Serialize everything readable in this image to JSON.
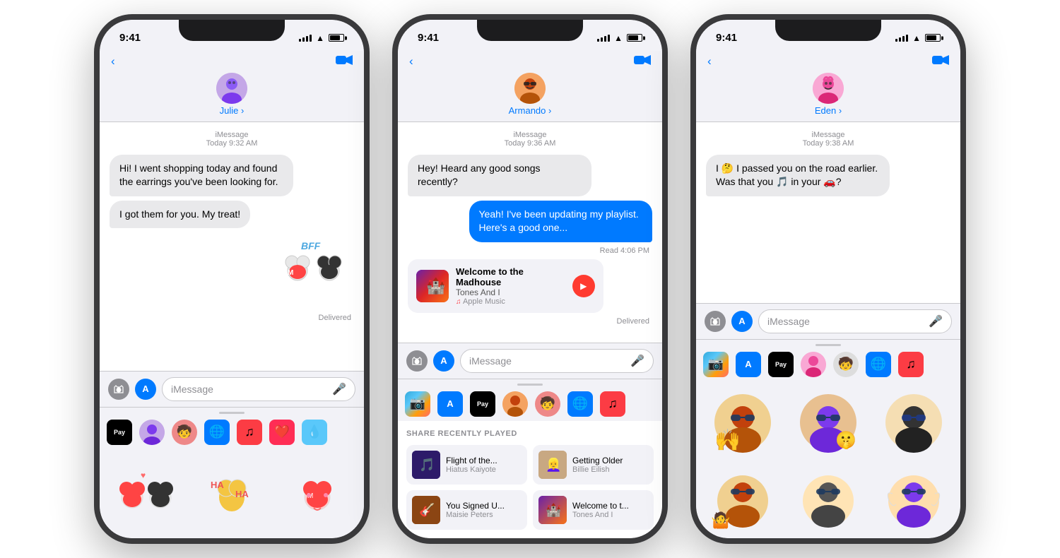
{
  "phones": [
    {
      "id": "phone1",
      "status": {
        "time": "9:41",
        "signal": [
          3,
          4,
          5,
          6,
          7
        ],
        "wifi": true,
        "battery": true
      },
      "header": {
        "contact_name": "Julie ›",
        "avatar_emoji": "🧑‍🎤",
        "avatar_bg": "#c4a7e7"
      },
      "messages": [
        {
          "type": "timestamp",
          "text": "iMessage\nToday 9:32 AM"
        },
        {
          "type": "received",
          "text": "Hi! I went shopping today and found the earrings you've been looking for."
        },
        {
          "type": "received",
          "text": "I got them for you. My treat!"
        },
        {
          "type": "sticker",
          "emoji": "🐭",
          "label": "BFF Sticker"
        },
        {
          "type": "status",
          "text": "Delivered"
        }
      ],
      "input_placeholder": "iMessage",
      "panel_type": "stickers",
      "drawer_icons": [
        "📷",
        "A",
        "ApplePay",
        "🧑",
        "🧒",
        "🌐",
        "♪",
        "❤️",
        "💧"
      ]
    },
    {
      "id": "phone2",
      "status": {
        "time": "9:41"
      },
      "header": {
        "contact_name": "Armando ›",
        "avatar_emoji": "🧑‍🦱",
        "avatar_bg": "#f4a261"
      },
      "messages": [
        {
          "type": "timestamp",
          "text": "iMessage\nToday 9:36 AM"
        },
        {
          "type": "received",
          "text": "Hey! Heard any good songs recently?"
        },
        {
          "type": "sent",
          "text": "Yeah! I've been updating my playlist. Here's a good one..."
        },
        {
          "type": "read",
          "text": "Read 4:06 PM"
        },
        {
          "type": "music_card",
          "title": "Welcome to the Madhouse",
          "artist": "Tones And I",
          "service": "Apple Music",
          "thumb_emoji": "🏰"
        },
        {
          "type": "status",
          "text": "Delivered"
        }
      ],
      "input_placeholder": "iMessage",
      "panel_type": "music",
      "panel_title": "SHARE RECENTLY PLAYED",
      "recently_played": [
        {
          "title": "Flight of the...",
          "artist": "Hiatus Kaiyote",
          "bg": "#2d1b69"
        },
        {
          "title": "Getting Older",
          "artist": "Billie Eilish",
          "bg": "#c8a882"
        },
        {
          "title": "You Signed U...",
          "artist": "Maisie Peters",
          "bg": "#8b4513"
        },
        {
          "title": "Welcome to t...",
          "artist": "Tones And I",
          "bg": "#6b21a8"
        }
      ],
      "drawer_icons": [
        "📷",
        "A",
        "ApplePay",
        "🧑",
        "🧒",
        "🌐",
        "♪"
      ]
    },
    {
      "id": "phone3",
      "status": {
        "time": "9:41"
      },
      "header": {
        "contact_name": "Eden ›",
        "avatar_emoji": "👩‍🦱",
        "avatar_bg": "#f9a8d4"
      },
      "messages": [
        {
          "type": "timestamp",
          "text": "iMessage\nToday 9:38 AM"
        },
        {
          "type": "received",
          "text": "I 🤔 I passed you on the road earlier. Was that you 🎵 in your 🚗?"
        }
      ],
      "input_placeholder": "iMessage",
      "panel_type": "memoji",
      "drawer_icons": [
        "📷",
        "A",
        "ApplePay",
        "🧑",
        "🧒",
        "🌐",
        "♪"
      ]
    }
  ]
}
